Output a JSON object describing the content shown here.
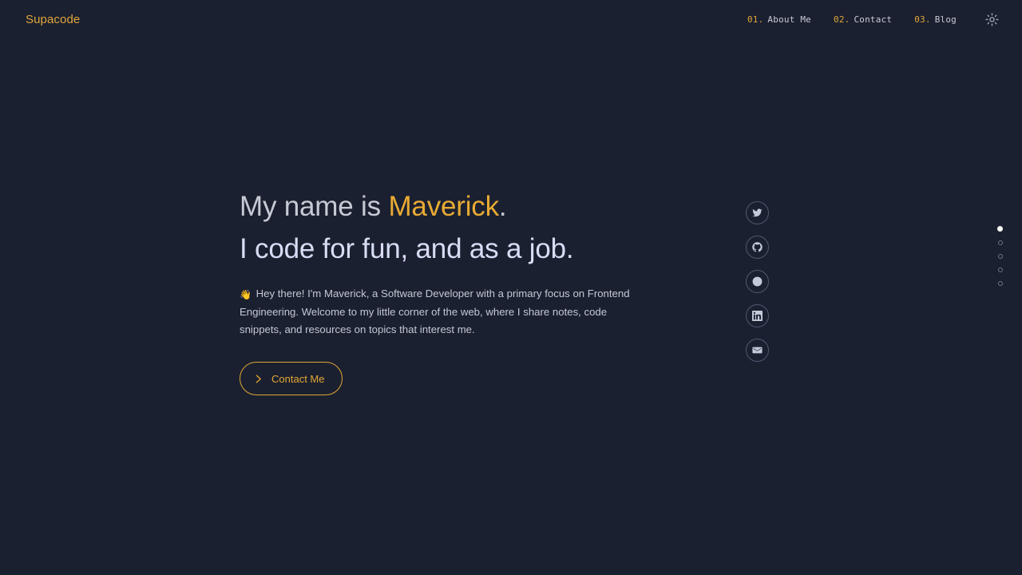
{
  "theme": {
    "background": "#1b2030",
    "accent": "#e0a63a",
    "heading_primary": "#c6cad4",
    "heading_secondary": "#d8dcf5",
    "body_text": "#c3c8d4",
    "social_border": "#4e5870"
  },
  "header": {
    "brand": "Supacode",
    "nav": [
      {
        "num": "01.",
        "label": "About Me",
        "name": "nav-about-me"
      },
      {
        "num": "02.",
        "label": "Contact",
        "name": "nav-contact"
      },
      {
        "num": "03.",
        "label": "Blog",
        "name": "nav-blog"
      }
    ],
    "theme_toggle_icon": "sun-icon"
  },
  "hero": {
    "headline_1_prefix": "My name is ",
    "headline_1_accent": "Maverick",
    "headline_1_period": ".",
    "headline_2": "I code for fun, and as a job.",
    "wave_emoji": "👋",
    "bio": "Hey there! I'm Maverick, a Software Developer with a primary focus on Frontend Engineering. Welcome to my little corner of the web, where I share notes, code snippets, and resources on topics that interest me.",
    "cta_label": "Contact Me",
    "cta_icon": "chevron-right-icon"
  },
  "social": [
    {
      "icon": "twitter-icon",
      "name": "social-link-twitter"
    },
    {
      "icon": "github-icon",
      "name": "social-link-github"
    },
    {
      "icon": "dribbble-icon",
      "name": "social-link-dribbble"
    },
    {
      "icon": "linkedin-icon",
      "name": "social-link-linkedin"
    },
    {
      "icon": "email-icon",
      "name": "social-link-email"
    }
  ],
  "section_dots": {
    "count": 5,
    "active_index": 0
  }
}
